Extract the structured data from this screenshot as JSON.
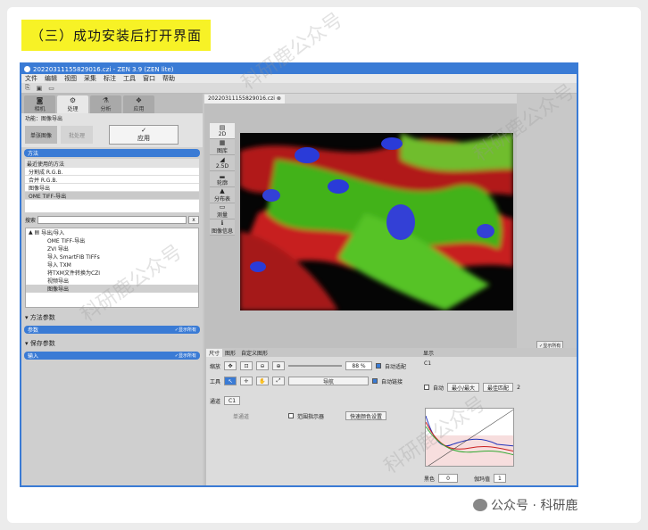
{
  "heading": "（三）成功安装后打开界面",
  "app": {
    "title": "20220311155829016.czi - ZEN 3.9 (ZEN lite)",
    "menu": [
      "文件",
      "编辑",
      "视图",
      "采集",
      "标注",
      "工具",
      "窗口",
      "帮助"
    ],
    "left_tabs": [
      {
        "label": "相机",
        "icon": "camera-icon"
      },
      {
        "label": "处理",
        "icon": "gear-icon"
      },
      {
        "label": "分析",
        "icon": "flask-icon"
      },
      {
        "label": "应用",
        "icon": "apps-icon"
      }
    ],
    "function_label": "功能：图像导出",
    "modes": {
      "single": "单张图像",
      "batch": "批处理"
    },
    "apply_label": "应用",
    "method_bar": "方法",
    "recent_label": "最近使用的方法",
    "recent_methods": [
      "分割成 R.G.B.",
      "合并 R.G.B.",
      "图像导出",
      "OME TIFF-导出"
    ],
    "search_label": "搜索",
    "tree_category": "导出/导入",
    "tree_items": [
      "OME TIFF-导出",
      "ZVI 导出",
      "导入 SmartFIB TIFFs",
      "导入 TXM",
      "将TXM文件转换为CZI",
      "视频导出",
      "图像导出"
    ],
    "method_params": "方法参数",
    "params_bar": "参数",
    "save_params": "保存参数",
    "input_bar": "输入",
    "show_all": "✓显示所有",
    "doc_tab": "20220311155829016.czi",
    "side_buttons": [
      "2D",
      "图库",
      "2.5D",
      "轮廓",
      "分布表",
      "测量",
      "图像信息"
    ],
    "dims_tabs": [
      "尺寸",
      "图形",
      "自定义图形"
    ],
    "zoom_label": "缩放",
    "zoom_value": "88 %",
    "zoom_fit": "自动适配",
    "tool_label": "工具",
    "nav_label": "导航",
    "auto_link": "自动链接",
    "channel_label": "通道",
    "channel_name": "C1",
    "single_channel": "单通道",
    "range_label": "范围指示器",
    "quick_color": "快速颜色设置",
    "display_label": "显示",
    "display_options": "显示所有",
    "auto": "自动",
    "minmax": "最小/最大",
    "best_fit": "最佳匹配",
    "black_label": "黑色",
    "black_value": "0",
    "gamma_label": "伽玛值",
    "gamma_value": "1",
    "hist_channel": "C1",
    "fit_value": "2"
  },
  "footer": "公众号 · 科研鹿",
  "watermark": "科研鹿公众号"
}
